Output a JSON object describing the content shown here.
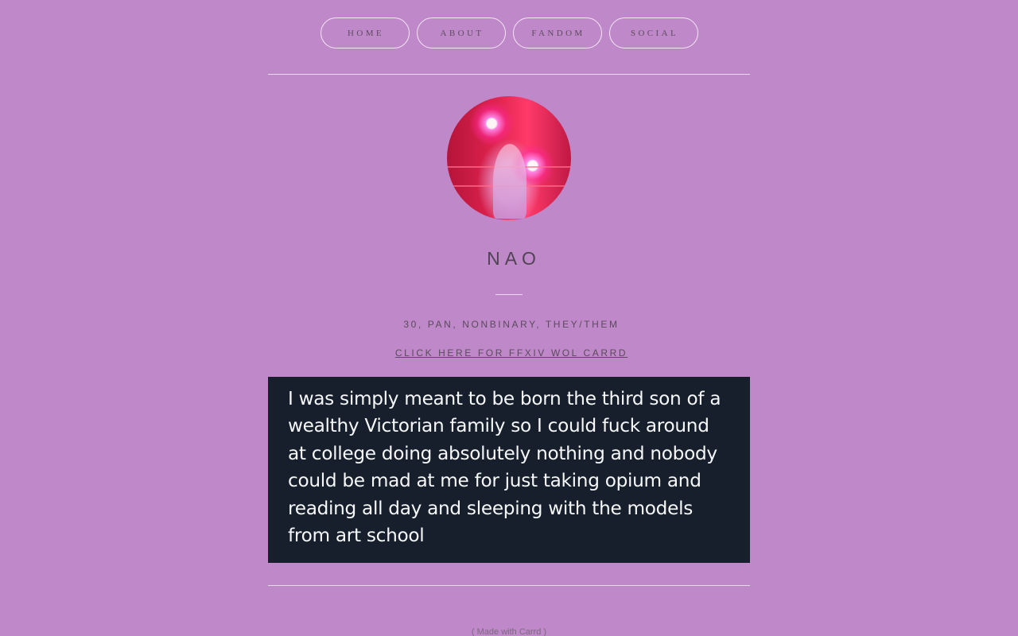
{
  "nav": {
    "items": [
      {
        "label": "HOME"
      },
      {
        "label": "ABOUT"
      },
      {
        "label": "FANDOM"
      },
      {
        "label": "SOCIAL"
      }
    ]
  },
  "profile": {
    "name": "NAO",
    "subtitle": "30, PAN, NONBINARY, THEY/THEM",
    "link_text": "CLICK HERE FOR FFXIV WOL CARRD"
  },
  "quote": {
    "text": "I was simply meant to be born the third son of a wealthy Victorian family so I could fuck around at college doing absolutely nothing and nobody could be mad at me for just taking opium and reading all day and sleeping with the models from art school"
  },
  "footer": {
    "text": "( Made with Carrd )"
  },
  "colors": {
    "background": "#bf88c8",
    "quote_background": "#161f2b",
    "quote_text": "#f6f7f9",
    "text": "#5a4b5d"
  }
}
